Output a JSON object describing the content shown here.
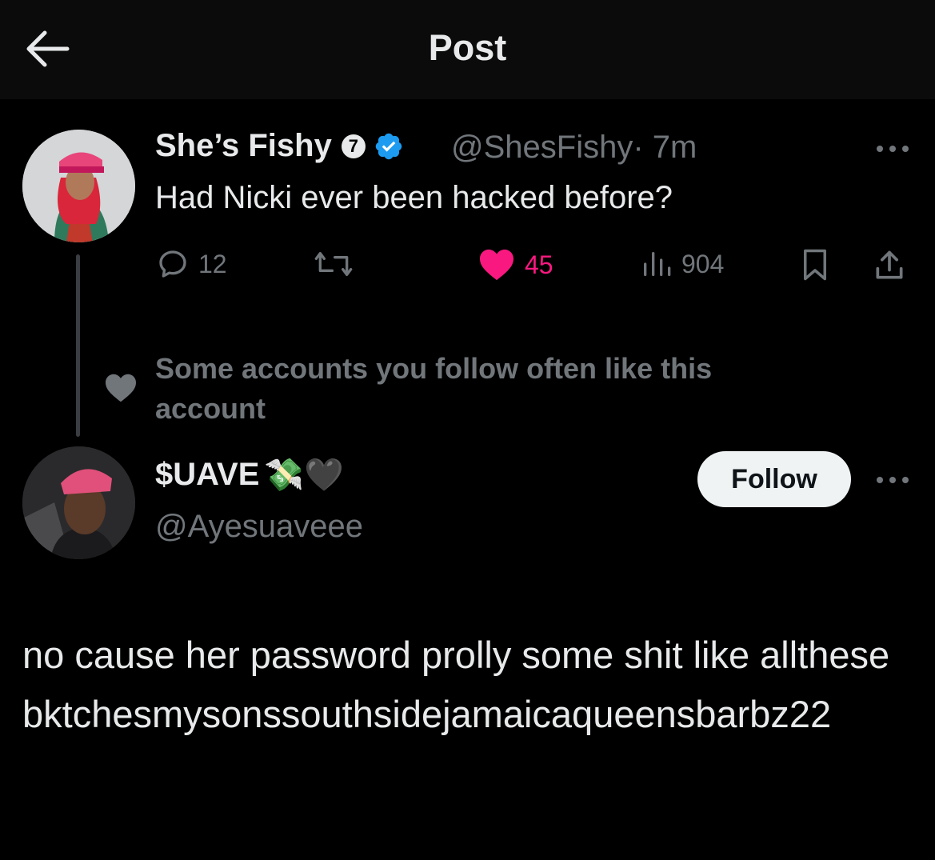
{
  "header": {
    "title": "Post"
  },
  "tweet": {
    "author_name": "She’s Fishy",
    "badge_number": "7",
    "handle": "@ShesFishy",
    "time": "· 7m",
    "text": "Had Nicki ever been hacked before?",
    "stats": {
      "replies": "12",
      "likes": "45",
      "views": "904"
    },
    "like_color": "#f91880"
  },
  "social_context": "Some accounts you follow often like this account",
  "reply": {
    "author_name": "$UAVE",
    "name_emojis": "💸🖤",
    "handle": "@Ayesuaveee",
    "follow_label": "Follow",
    "text": "no cause her password prolly some shit  like allthesebktchesmysonssouthsidejamaicaqueensbarbz22"
  },
  "colors": {
    "background": "#000000",
    "text": "#e7e9ea",
    "muted": "#71767b",
    "verified": "#1d9bf0"
  }
}
